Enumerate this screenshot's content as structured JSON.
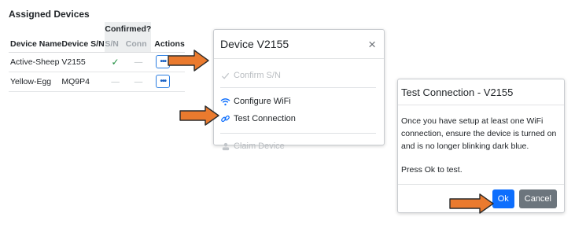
{
  "devices_panel": {
    "title": "Assigned Devices",
    "group_header": "Confirmed?",
    "columns": [
      "Device Name",
      "Device S/N",
      "S/N",
      "Conn",
      "Actions"
    ],
    "rows": [
      {
        "name": "Active-Sheep",
        "sn": "V2155",
        "sn_confirmed": "✓",
        "conn": "—",
        "action": "•••"
      },
      {
        "name": "Yellow-Egg",
        "sn": "MQ9P4",
        "sn_confirmed": "—",
        "conn": "—",
        "action": "•••"
      }
    ]
  },
  "device_menu": {
    "title": "Device V2155",
    "close": "×",
    "items": [
      {
        "label": "Confirm S/N",
        "icon": "check-icon",
        "enabled": false
      },
      {
        "label": "Configure WiFi",
        "icon": "wifi-icon",
        "enabled": true
      },
      {
        "label": "Test Connection",
        "icon": "link-icon",
        "enabled": true
      },
      {
        "label": "Claim Device",
        "icon": "person-icon",
        "enabled": false
      }
    ]
  },
  "test_modal": {
    "title": "Test Connection - V2155",
    "body_1": "Once you have setup at least one WiFi connection, ensure the device is turned on and is no longer blinking dark blue.",
    "body_2": "Press Ok to test.",
    "ok_label": "Ok",
    "cancel_label": "Cancel"
  },
  "colors": {
    "arrow_fill": "#ea7a2e",
    "arrow_stroke": "#2b2b2b",
    "primary": "#0d6efd",
    "secondary": "#6c757d",
    "success": "#1e8e3e"
  }
}
